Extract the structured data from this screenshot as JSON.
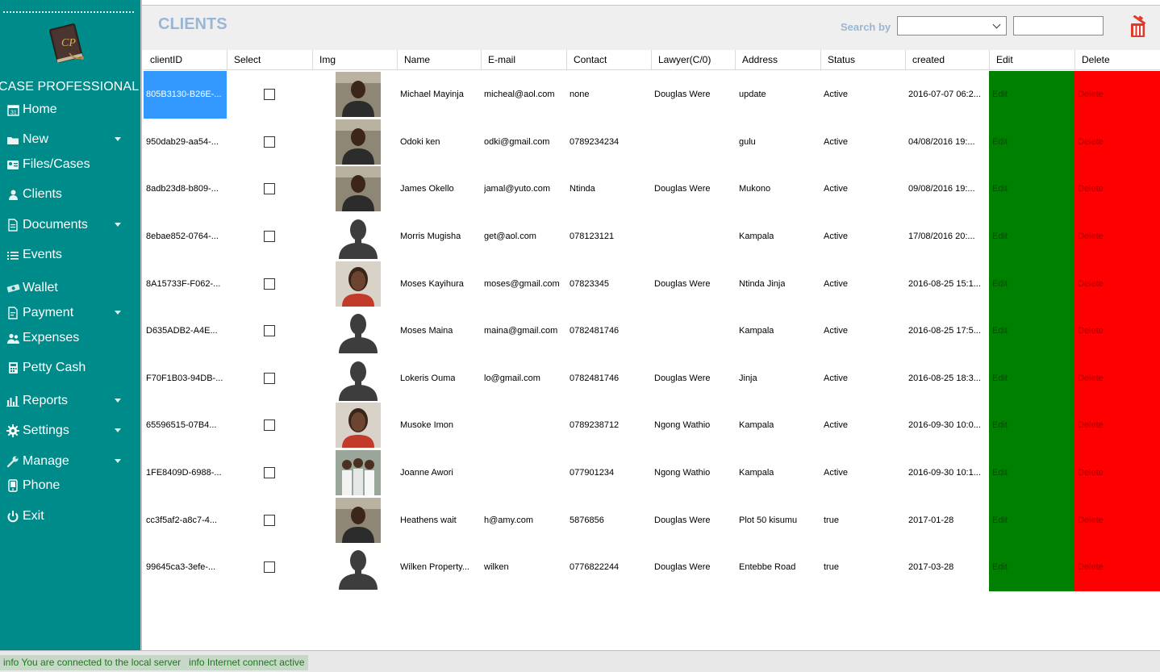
{
  "app": {
    "brand": "CASE PROFESSIONAL",
    "logo_text": "CP"
  },
  "sidebar": {
    "items": [
      {
        "label": "Home",
        "icon": "calendar-icon",
        "dropdown": false
      },
      {
        "label": "New",
        "icon": "folder-icon",
        "dropdown": true
      },
      {
        "label": "Files/Cases",
        "icon": "id-card-icon",
        "dropdown": false
      },
      {
        "label": "Clients",
        "icon": "user-icon",
        "dropdown": false
      },
      {
        "label": "Documents",
        "icon": "document-icon",
        "dropdown": true
      },
      {
        "label": "Events",
        "icon": "list-icon",
        "dropdown": false
      },
      {
        "label": "Wallet",
        "icon": "money-icon",
        "dropdown": false
      },
      {
        "label": "Payment",
        "icon": "receipt-icon",
        "dropdown": true
      },
      {
        "label": "Expenses",
        "icon": "users-icon",
        "dropdown": false
      },
      {
        "label": "Petty Cash",
        "icon": "calculator-icon",
        "dropdown": false
      },
      {
        "label": "Reports",
        "icon": "bar-chart-icon",
        "dropdown": true
      },
      {
        "label": "Settings",
        "icon": "gear-icon",
        "dropdown": true
      },
      {
        "label": "Manage",
        "icon": "wrench-icon",
        "dropdown": true
      },
      {
        "label": "Phone",
        "icon": "phone-icon",
        "dropdown": false
      },
      {
        "label": "Exit",
        "icon": "power-icon",
        "dropdown": false
      }
    ]
  },
  "header": {
    "title": "CLIENTS",
    "search_label": "Search by",
    "search_select_value": "",
    "search_value": ""
  },
  "table": {
    "columns": [
      "clientID",
      "Select",
      "Img",
      "Name",
      "E-mail",
      "Contact",
      "Lawyer(C/0)",
      "Address",
      "Status",
      "created",
      "Edit",
      "Delete"
    ],
    "rows": [
      {
        "id": "805B3130-B26E-...",
        "img": "photo-man",
        "name": "Michael Mayinja",
        "email": "micheal@aol.com",
        "contact": "none",
        "lawyer": "Douglas Were",
        "address": "update",
        "status": "Active",
        "created": "2016-07-07 06:2...",
        "edit": "Edit",
        "delete": "Delete",
        "selected": true
      },
      {
        "id": "950dab29-aa54-...",
        "img": "photo-man",
        "name": "Odoki ken",
        "email": "odki@gmail.com",
        "contact": "0789234234",
        "lawyer": "",
        "address": "gulu",
        "status": "Active",
        "created": "04/08/2016 19:...",
        "edit": "Edit",
        "delete": "Delete",
        "selected": false
      },
      {
        "id": "8adb23d8-b809-...",
        "img": "photo-man",
        "name": "James Okello",
        "email": "jamal@yuto.com",
        "contact": "Ntinda",
        "lawyer": "Douglas Were",
        "address": "Mukono",
        "status": "Active",
        "created": "09/08/2016 19:...",
        "edit": "Edit",
        "delete": "Delete",
        "selected": false
      },
      {
        "id": "8ebae852-0764-...",
        "img": "silhouette",
        "name": "Morris Mugisha",
        "email": "get@aol.com",
        "contact": "078123121",
        "lawyer": "",
        "address": "Kampala",
        "status": "Active",
        "created": "17/08/2016 20:...",
        "edit": "Edit",
        "delete": "Delete",
        "selected": false
      },
      {
        "id": "8A15733F-F062-...",
        "img": "photo-woman",
        "name": "Moses Kayihura",
        "email": "moses@gmail.com",
        "contact": "07823345",
        "lawyer": "Douglas Were",
        "address": "Ntinda Jinja",
        "status": "Active",
        "created": "2016-08-25 15:1...",
        "edit": "Edit",
        "delete": "Delete",
        "selected": false
      },
      {
        "id": "D635ADB2-A4E...",
        "img": "silhouette",
        "name": "Moses Maina",
        "email": "maina@gmail.com",
        "contact": "0782481746",
        "lawyer": "",
        "address": "Kampala",
        "status": "Active",
        "created": "2016-08-25 17:5...",
        "edit": "Edit",
        "delete": "Delete",
        "selected": false
      },
      {
        "id": "F70F1B03-94DB-...",
        "img": "silhouette",
        "name": "Lokeris Ouma",
        "email": "lo@gmail.com",
        "contact": "0782481746",
        "lawyer": "Douglas Were",
        "address": "Jinja",
        "status": "Active",
        "created": "2016-08-25 18:3...",
        "edit": "Edit",
        "delete": "Delete",
        "selected": false
      },
      {
        "id": "65596515-07B4...",
        "img": "photo-woman",
        "name": "Musoke Imon",
        "email": "",
        "contact": "0789238712",
        "lawyer": "Ngong Wathio",
        "address": "Kampala",
        "status": "Active",
        "created": "2016-09-30 10:0...",
        "edit": "Edit",
        "delete": "Delete",
        "selected": false
      },
      {
        "id": "1FE8409D-6988-...",
        "img": "photo-group",
        "name": "Joanne Awori",
        "email": "",
        "contact": "077901234",
        "lawyer": "Ngong Wathio",
        "address": "Kampala",
        "status": "Active",
        "created": "2016-09-30 10:1...",
        "edit": "Edit",
        "delete": "Delete",
        "selected": false
      },
      {
        "id": "cc3f5af2-a8c7-4...",
        "img": "photo-man",
        "name": "Heathens wait",
        "email": "h@amy.com",
        "contact": "5876856",
        "lawyer": "Douglas Were",
        "address": "Plot 50 kisumu",
        "status": "true",
        "created": "2017-01-28",
        "edit": "Edit",
        "delete": "Delete",
        "selected": false
      },
      {
        "id": "99645ca3-3efe-...",
        "img": "silhouette",
        "name": "Wilken Property...",
        "email": "wilken",
        "contact": "0776822244",
        "lawyer": "Douglas Were",
        "address": "Entebbe Road",
        "status": "true",
        "created": "2017-03-28",
        "edit": "Edit",
        "delete": "Delete",
        "selected": false
      }
    ]
  },
  "statusbar": {
    "text": "info You are connected to the local server   info Internet connect active"
  },
  "colors": {
    "sidebar": "#008b8b",
    "title": "#9ab6d6",
    "edit": "#008000",
    "delete": "#ff0000",
    "selected": "#3399ff"
  }
}
